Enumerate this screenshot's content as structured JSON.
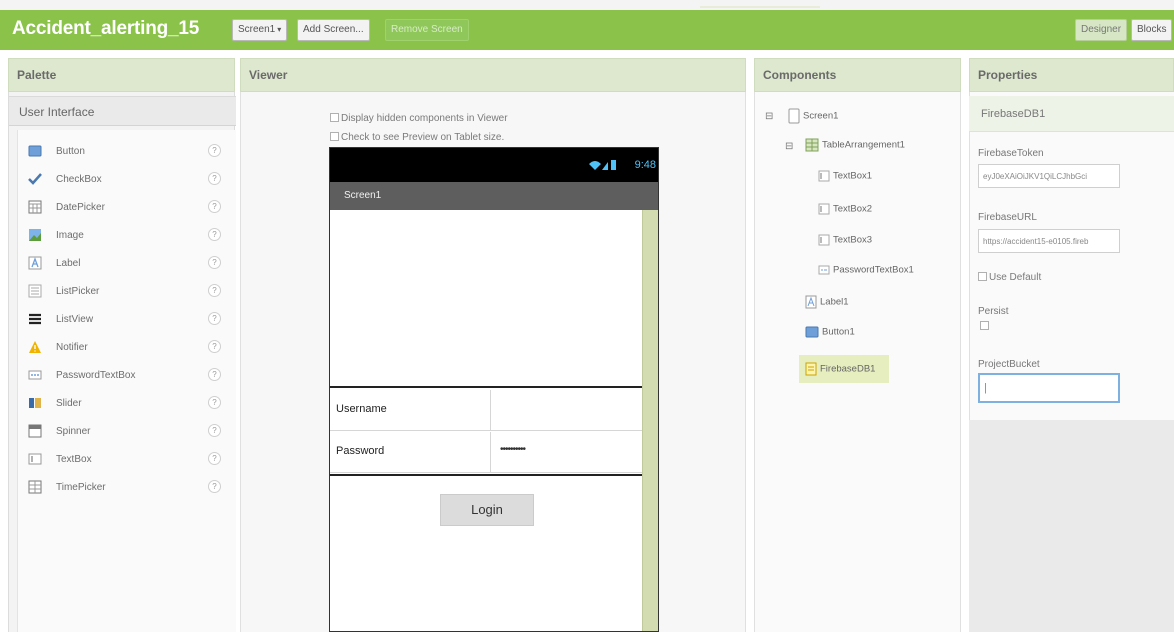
{
  "app": {
    "project_title": "Accident_alerting_15"
  },
  "toolbar": {
    "screen_select": "Screen1",
    "add_screen": "Add Screen...",
    "remove_screen": "Remove Screen",
    "designer": "Designer",
    "blocks": "Blocks"
  },
  "palette": {
    "title": "Palette",
    "section": "User Interface",
    "help_glyph": "?",
    "items": [
      {
        "label": "Button",
        "icon": "button-icon"
      },
      {
        "label": "CheckBox",
        "icon": "checkbox-icon"
      },
      {
        "label": "DatePicker",
        "icon": "datepicker-icon"
      },
      {
        "label": "Image",
        "icon": "image-icon"
      },
      {
        "label": "Label",
        "icon": "label-icon"
      },
      {
        "label": "ListPicker",
        "icon": "listpicker-icon"
      },
      {
        "label": "ListView",
        "icon": "listview-icon"
      },
      {
        "label": "Notifier",
        "icon": "notifier-icon"
      },
      {
        "label": "PasswordTextBox",
        "icon": "password-icon"
      },
      {
        "label": "Slider",
        "icon": "slider-icon"
      },
      {
        "label": "Spinner",
        "icon": "spinner-icon"
      },
      {
        "label": "TextBox",
        "icon": "textbox-icon"
      },
      {
        "label": "TimePicker",
        "icon": "timepicker-icon"
      }
    ]
  },
  "viewer": {
    "title": "Viewer",
    "show_hidden": "Display hidden components in Viewer",
    "tablet_preview": "Check to see Preview on Tablet size.",
    "phone": {
      "time": "9:48",
      "screen_title": "Screen1",
      "username_label": "Username",
      "password_label": "Password",
      "password_value": "••••••••••",
      "login_button": "Login"
    }
  },
  "components": {
    "title": "Components",
    "tree": {
      "screen": "Screen1",
      "table": "TableArrangement1",
      "textbox1": "TextBox1",
      "textbox2": "TextBox2",
      "textbox3": "TextBox3",
      "password": "PasswordTextBox1",
      "label": "Label1",
      "button": "Button1",
      "firebase": "FirebaseDB1"
    },
    "toggle_glyph": "⊟"
  },
  "properties": {
    "title": "Properties",
    "component": "FirebaseDB1",
    "firebase_token_label": "FirebaseToken",
    "firebase_token_value": "eyJ0eXAiOiJKV1QiLCJhbGci",
    "firebase_url_label": "FirebaseURL",
    "firebase_url_value": "https://accident15-e0105.fireb",
    "use_default": "Use Default",
    "persist_label": "Persist",
    "project_bucket_label": "ProjectBucket",
    "project_bucket_value": "|"
  },
  "colors": {
    "header_green": "#8bc34a",
    "panel_header": "#dde8cf",
    "selection": "#e6edbe",
    "phone_status": "#000000",
    "phone_title": "#5e5e5e",
    "status_accent": "#4fc3f7"
  }
}
